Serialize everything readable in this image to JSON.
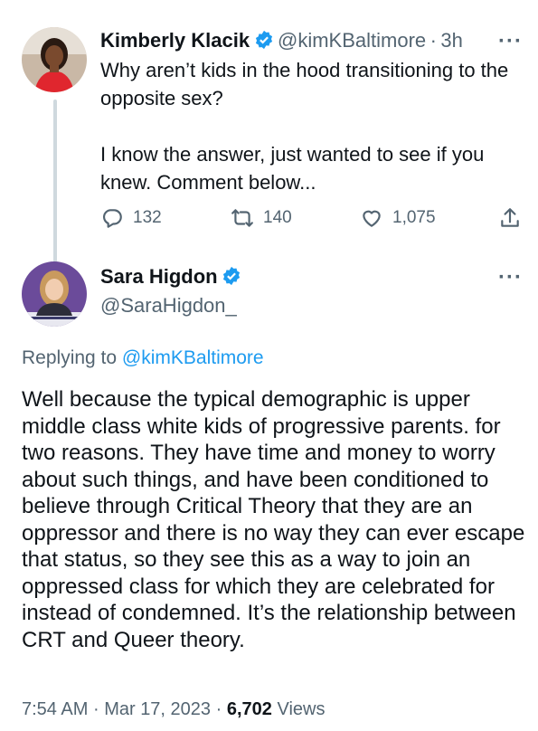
{
  "colors": {
    "accent": "#1d9bf0",
    "secondary_text": "#536471",
    "primary_text": "#0f1419"
  },
  "tweet1": {
    "name": "Kimberly Klacik",
    "verified": true,
    "handle": "@kimKBaltimore",
    "separator": "·",
    "time": "3h",
    "more": "···",
    "text": "Why aren’t kids in the hood transitioning to the opposite sex?\n\nI know the answer, just wanted to see if you knew. Comment below...",
    "replies": "132",
    "retweets": "140",
    "likes": "1,075"
  },
  "tweet2": {
    "name": "Sara Higdon",
    "verified": true,
    "handle": "@SaraHigdon_",
    "more": "···",
    "replying_prefix": "Replying to",
    "replying_handle": "@kimKBaltimore",
    "text": "Well because the typical demographic is upper middle class white kids of progressive parents. for two reasons. They have time and money to worry about such things, and have been conditioned to believe through Critical Theory that they are an oppressor and there is no way they can ever escape that status, so they see this as a way to join an oppressed class for which they are celebrated for instead of condemned. It’s the relationship between CRT and Queer theory.",
    "time": "7:54 AM",
    "sep1": "·",
    "date": "Mar 17, 2023",
    "sep2": "·",
    "views_count": "6,702",
    "views_label": "Views"
  }
}
